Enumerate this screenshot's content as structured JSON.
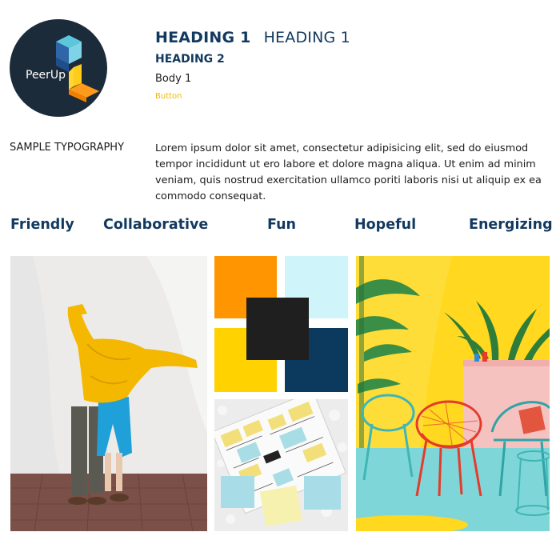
{
  "brand": {
    "logo_text": "PeerUp"
  },
  "typography": {
    "heading1_bold": "HEADING 1",
    "heading1_light": "HEADING 1",
    "heading2": "HEADING 2",
    "body1": "Body 1",
    "button": "Button"
  },
  "sample": {
    "label": "SAMPLE TYPOGRAPHY",
    "paragraph": "Lorem ipsum dolor sit amet, consectetur adipisicing elit, sed do eiusmod tempor incididunt ut ero labore et dolore magna aliqua. Ut enim ad minim veniam, quis nostrud exercitation ullamco poriti laboris nisi ut aliquip ex ea commodo consequat."
  },
  "traits": [
    "Friendly",
    "Collaborative",
    "Fun",
    "Hopeful",
    "Energizing"
  ],
  "palette": {
    "orange": "#ff9500",
    "light_cyan": "#cff5fb",
    "yellow": "#ffd200",
    "navy": "#0b3a5e",
    "black": "#1f1f1f",
    "heading_navy": "#12395f",
    "button_yellow": "#f2b800"
  },
  "images": {
    "left": "photo-person-yellow-sweater",
    "middle_bottom": "photo-sticky-notes-sketch",
    "right": "photo-yellow-room-chairs"
  }
}
